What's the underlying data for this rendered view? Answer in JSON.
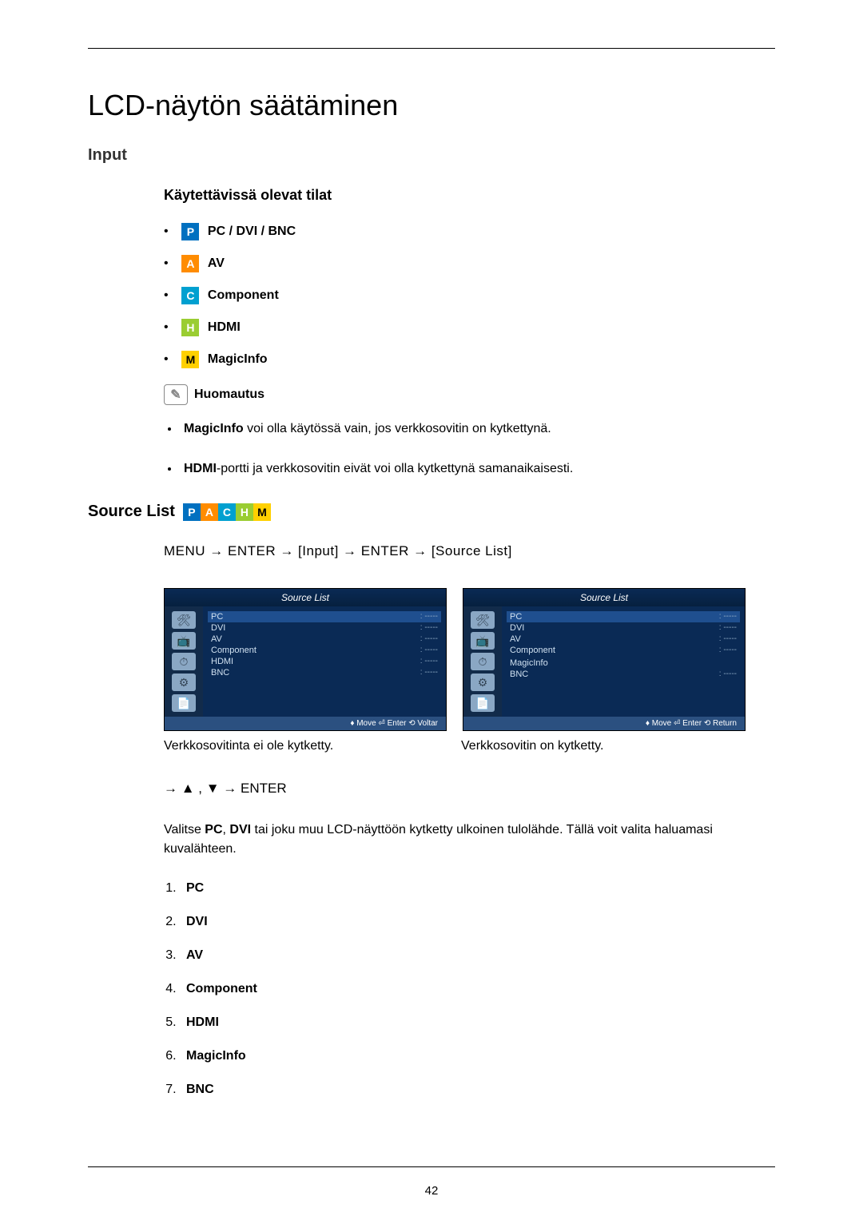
{
  "title": "LCD-näytön säätäminen",
  "section": "Input",
  "available_modes_heading": "Käytettävissä olevat tilat",
  "modes": [
    {
      "icon": "P",
      "label": "PC / DVI / BNC"
    },
    {
      "icon": "A",
      "label": "AV"
    },
    {
      "icon": "C",
      "label": "Component"
    },
    {
      "icon": "H",
      "label": "HDMI"
    },
    {
      "icon": "M",
      "label": "MagicInfo"
    }
  ],
  "note_label": "Huomautus",
  "notes": {
    "n1_bold": "MagicInfo",
    "n1_text": " voi olla käytössä vain, jos verkkosovitin on kytkettynä.",
    "n2_bold": "HDMI",
    "n2_text": "-portti ja verkkosovitin eivät voi olla kytkettynä samanaikaisesti."
  },
  "source_list_heading": "Source List",
  "menu_path": "MENU → ENTER → [Input] → ENTER → [Source List]",
  "osd": {
    "title": "Source List",
    "footer_left": "♦ Move    ⏎ Enter    ⟲ Voltar",
    "footer_right": "♦ Move    ⏎ Enter    ⟲ Return",
    "left_items": [
      "PC",
      "DVI",
      "AV",
      "Component",
      "HDMI",
      "BNC"
    ],
    "right_items": [
      "PC",
      "DVI",
      "AV",
      "Component",
      "",
      "MagicInfo",
      "BNC"
    ],
    "dash": ": -----"
  },
  "captions": {
    "left": "Verkkosovitinta ei ole kytketty.",
    "right": "Verkkosovitin on kytketty."
  },
  "nav_hint": "→ ▲ , ▼ → ENTER",
  "body_para_pre": "Valitse ",
  "body_para_b1": "PC",
  "body_para_mid": ", ",
  "body_para_b2": "DVI",
  "body_para_post": " tai joku muu LCD-näyttöön kytketty ulkoinen tulolähde. Tällä voit valita haluamasi kuvalähteen.",
  "numbered": [
    "PC",
    "DVI",
    "AV",
    "Component",
    "HDMI",
    "MagicInfo",
    "BNC"
  ],
  "page_number": "42"
}
